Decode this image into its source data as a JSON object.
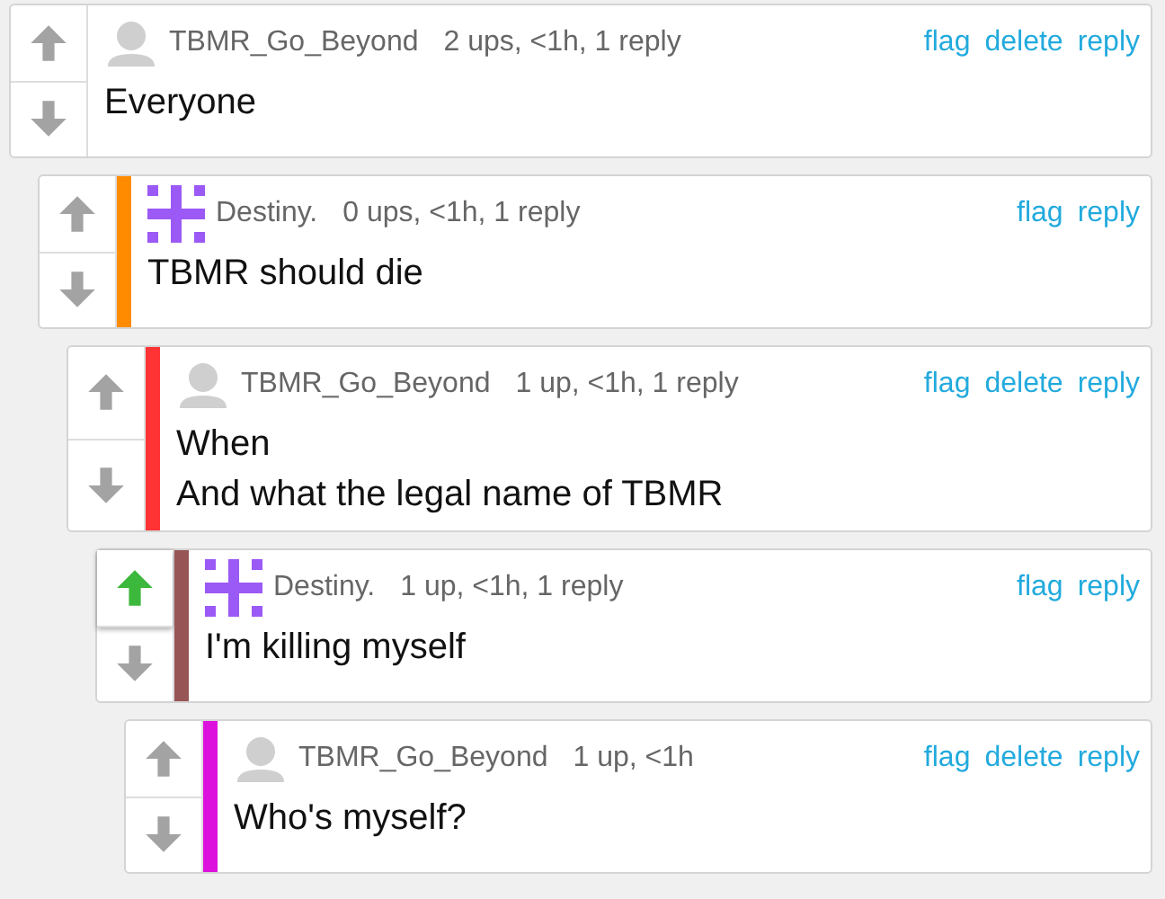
{
  "comments": [
    {
      "user": "TBMR_Go_Beyond",
      "avatar": {
        "kind": "silhouette"
      },
      "meta": "2 ups, <1h, 1 reply",
      "text": "Everyone",
      "actions": [
        "flag",
        "delete",
        "reply"
      ],
      "upvoted": false,
      "children": [
        {
          "user": "Destiny.",
          "avatar": {
            "kind": "pattern"
          },
          "color": "#ff8c00",
          "meta": "0 ups, <1h, 1 reply",
          "text": "TBMR should die",
          "actions": [
            "flag",
            "reply"
          ],
          "upvoted": false,
          "children": [
            {
              "user": "TBMR_Go_Beyond",
              "avatar": {
                "kind": "silhouette"
              },
              "color": "#ff3333",
              "meta": "1 up, <1h, 1 reply",
              "text": "When\nAnd what the legal name of TBMR",
              "actions": [
                "flag",
                "delete",
                "reply"
              ],
              "upvoted": false,
              "children": [
                {
                  "user": "Destiny.",
                  "avatar": {
                    "kind": "pattern"
                  },
                  "color": "#985555",
                  "meta": "1 up, <1h, 1 reply",
                  "text": "I'm killing myself",
                  "actions": [
                    "flag",
                    "reply"
                  ],
                  "upvoted": true,
                  "children": [
                    {
                      "user": "TBMR_Go_Beyond",
                      "avatar": {
                        "kind": "silhouette"
                      },
                      "color": "#dd11dd",
                      "meta": "1 up, <1h",
                      "text": "Who's myself?",
                      "actions": [
                        "flag",
                        "delete",
                        "reply"
                      ],
                      "upvoted": false
                    }
                  ]
                }
              ]
            }
          ]
        }
      ]
    }
  ]
}
